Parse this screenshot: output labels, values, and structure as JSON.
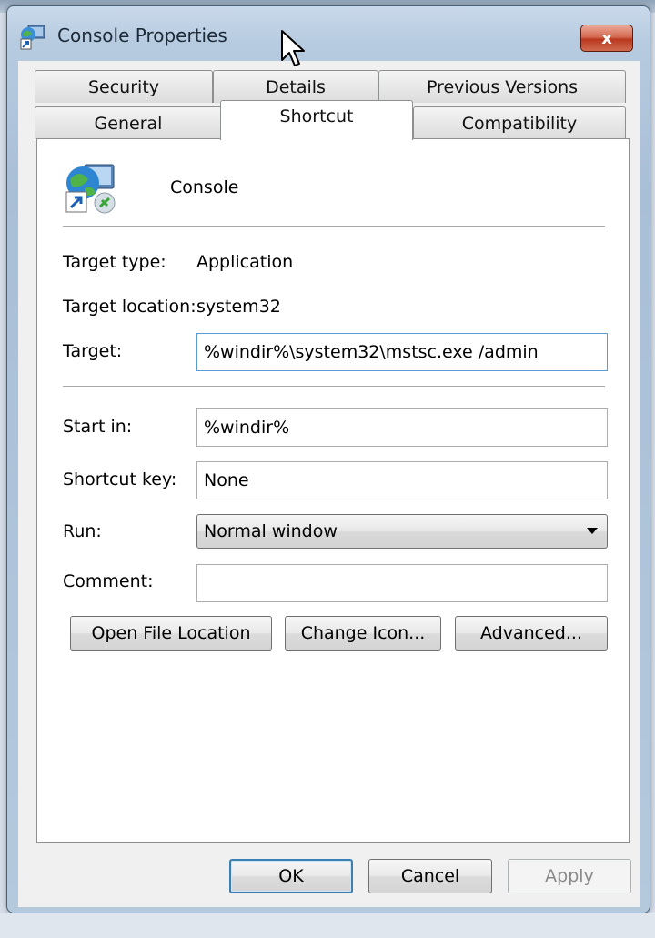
{
  "window": {
    "title": "Console Properties",
    "close_label": "x"
  },
  "tabs": {
    "row1": [
      {
        "label": "Security"
      },
      {
        "label": "Details"
      },
      {
        "label": "Previous Versions"
      }
    ],
    "row2": [
      {
        "label": "General"
      },
      {
        "label": "Shortcut",
        "active": true
      },
      {
        "label": "Compatibility"
      }
    ]
  },
  "shortcut": {
    "app_name": "Console",
    "target_type_label": "Target type:",
    "target_type_value": "Application",
    "target_location_label": "Target location:",
    "target_location_value": "system32",
    "target_label": "Target:",
    "target_value": "%windir%\\system32\\mstsc.exe /admin",
    "start_in_label": "Start in:",
    "start_in_value": "%windir%",
    "shortcut_key_label": "Shortcut key:",
    "shortcut_key_value": "None",
    "run_label": "Run:",
    "run_value": "Normal window",
    "comment_label": "Comment:",
    "comment_value": "",
    "open_file_location_label": "Open File Location",
    "change_icon_label": "Change Icon...",
    "advanced_label": "Advanced..."
  },
  "footer": {
    "ok_label": "OK",
    "cancel_label": "Cancel",
    "apply_label": "Apply"
  },
  "colors": {
    "focus_border": "#5b9bd5",
    "default_button_border": "#3c7fb1",
    "close_button": "#c8452b"
  }
}
